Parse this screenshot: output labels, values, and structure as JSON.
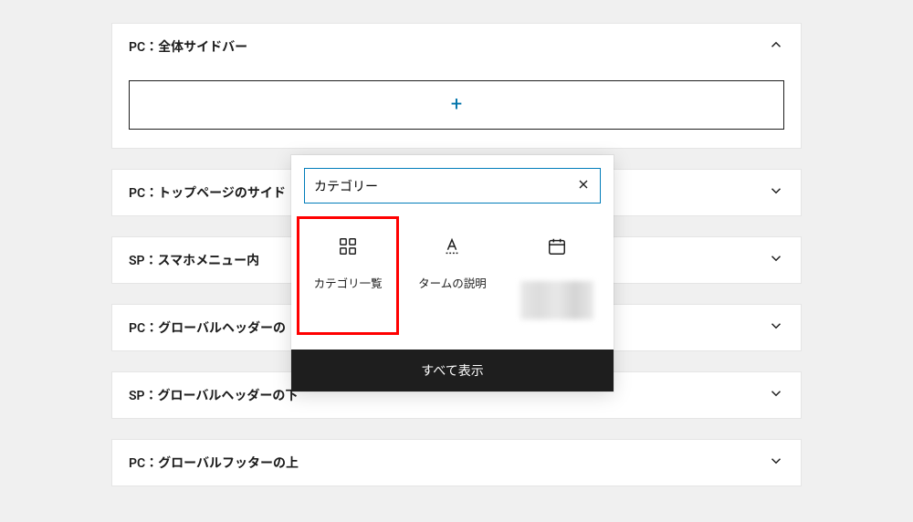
{
  "panels": {
    "p0": {
      "title": "PC：全体サイドバー",
      "expanded": true
    },
    "p1": {
      "title": "PC：トップページのサイド"
    },
    "p2": {
      "title": "SP：スマホメニュー内"
    },
    "p3": {
      "title": "PC：グローバルヘッダーの"
    },
    "p4": {
      "title": "SP：グローバルヘッダーの下"
    },
    "p5": {
      "title": "PC：グローバルフッターの上"
    }
  },
  "popover": {
    "search_value": "カテゴリー",
    "blocks": {
      "b0": {
        "label": "カテゴリ一覧",
        "icon": "grid-icon"
      },
      "b1": {
        "label": "タームの説明",
        "icon": "text-color-icon"
      },
      "b2": {
        "label": "",
        "icon": "calendar-icon"
      }
    },
    "footer_label": "すべて表示"
  }
}
